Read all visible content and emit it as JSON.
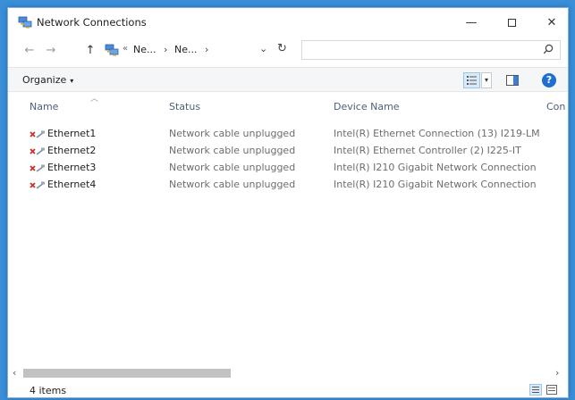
{
  "window": {
    "title": "Network Connections",
    "controls": {
      "minimize": "—",
      "close": "✕"
    }
  },
  "nav": {
    "back": "←",
    "forward": "→",
    "up": "↑",
    "address_overflow": "«",
    "breadcrumbs": [
      "Ne...",
      "Ne..."
    ],
    "chevron": "›",
    "dropdown": "⌄",
    "refresh": "↻",
    "search_value": ""
  },
  "toolbar": {
    "organize_label": "Organize",
    "organize_caret": "▾",
    "view_dropdown": "▾",
    "help_label": "?"
  },
  "columns": {
    "name": "Name",
    "status": "Status",
    "device": "Device Name",
    "connectivity": "Con"
  },
  "rows": [
    {
      "name": "Ethernet1",
      "status": "Network cable unplugged",
      "device": "Intel(R) Ethernet Connection (13) I219-LM"
    },
    {
      "name": "Ethernet2",
      "status": "Network cable unplugged",
      "device": "Intel(R) Ethernet Controller (2) I225-IT"
    },
    {
      "name": "Ethernet3",
      "status": "Network cable unplugged",
      "device": "Intel(R) I210 Gigabit Network Connection"
    },
    {
      "name": "Ethernet4",
      "status": "Network cable unplugged",
      "device": "Intel(R) I210 Gigabit Network Connection"
    }
  ],
  "scrollbar": {
    "left": "‹",
    "right": "›"
  },
  "status_bar": {
    "item_count": "4 items"
  },
  "colors": {
    "accent": "#1f6fd0",
    "error_x": "#d0312d",
    "desktop": "#3a8fd8"
  }
}
